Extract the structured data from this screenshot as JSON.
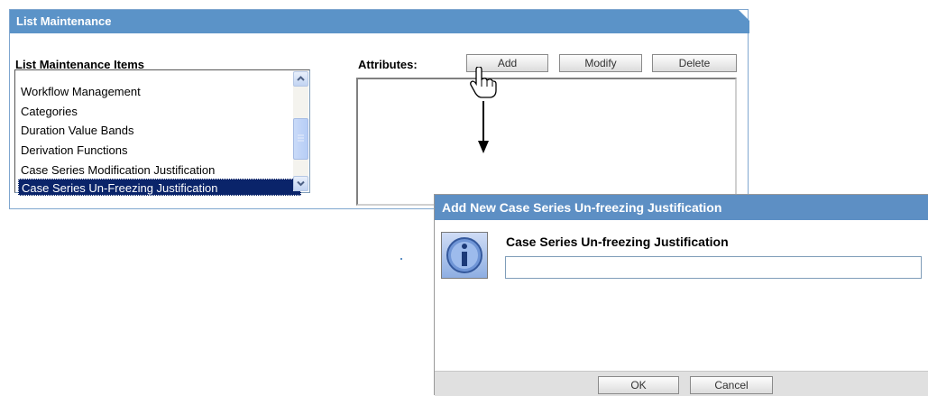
{
  "panel": {
    "title": "List Maintenance"
  },
  "list": {
    "heading": "List Maintenance Items",
    "items": [
      "Workflow Management",
      "Categories",
      "Duration Value Bands",
      "Derivation Functions",
      "Case Series Modification Justification",
      "Case Series Un-Freezing Justification"
    ],
    "selected_index": 5
  },
  "attributes": {
    "heading": "Attributes:",
    "add_label": "Add",
    "modify_label": "Modify",
    "delete_label": "Delete"
  },
  "dialog": {
    "title": "Add New Case Series Un-freezing Justification",
    "field_label": "Case Series Un-freezing Justification",
    "field_value": "",
    "ok_label": "OK",
    "cancel_label": "Cancel"
  },
  "colors": {
    "header": "#5b93c8",
    "dialog_header": "#5d8fc4",
    "selection": "#0a246a"
  },
  "icons": [
    "info-icon",
    "hand-cursor-icon",
    "arrow-down-icon",
    "scroll-up-icon",
    "scroll-down-icon"
  ]
}
